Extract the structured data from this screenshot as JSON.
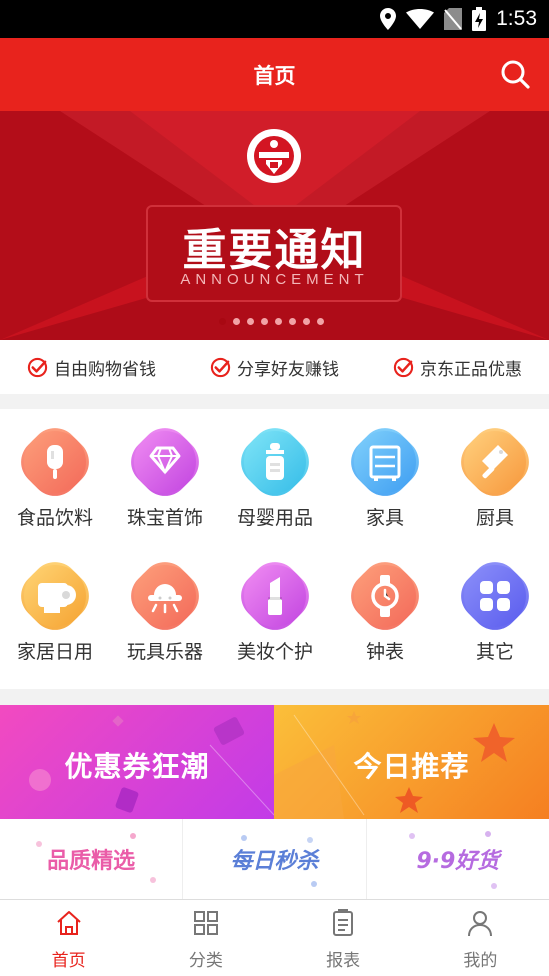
{
  "status_bar": {
    "time": "1:53"
  },
  "header": {
    "title": "首页"
  },
  "banner": {
    "headline": "重要通知",
    "subline": "ANNOUNCEMENT",
    "dot_count": 8,
    "active_dot": 0
  },
  "features": [
    {
      "label": "自由购物省钱"
    },
    {
      "label": "分享好友赚钱"
    },
    {
      "label": "京东正品优惠"
    }
  ],
  "categories": [
    {
      "label": "食品饮料",
      "icon": "popsicle-icon",
      "color_a": "#fd9e7a",
      "color_b": "#f36a5a"
    },
    {
      "label": "珠宝首饰",
      "icon": "diamond-icon",
      "color_a": "#f08cf2",
      "color_b": "#c245e0"
    },
    {
      "label": "母婴用品",
      "icon": "baby-bottle-icon",
      "color_a": "#7fe4f7",
      "color_b": "#36bde8"
    },
    {
      "label": "家具",
      "icon": "cabinet-icon",
      "color_a": "#80d0fb",
      "color_b": "#3f9ef2"
    },
    {
      "label": "厨具",
      "icon": "cleaver-icon",
      "color_a": "#ffd07d",
      "color_b": "#f7983d"
    },
    {
      "label": "家居日用",
      "icon": "toilet-paper-icon",
      "color_a": "#ffd474",
      "color_b": "#f5a332"
    },
    {
      "label": "玩具乐器",
      "icon": "ufo-toy-icon",
      "color_a": "#fd9e7a",
      "color_b": "#f36a5a"
    },
    {
      "label": "美妆个护",
      "icon": "lipstick-icon",
      "color_a": "#f08cf2",
      "color_b": "#c245e0"
    },
    {
      "label": "钟表",
      "icon": "watch-icon",
      "color_a": "#fd9e7a",
      "color_b": "#f36a5a"
    },
    {
      "label": "其它",
      "icon": "grid-apps-icon",
      "color_a": "#8b8ff9",
      "color_b": "#5a5cee"
    }
  ],
  "promos": [
    {
      "label": "优惠券狂潮"
    },
    {
      "label": "今日推荐"
    }
  ],
  "quick_links": [
    {
      "label": "品质精选"
    },
    {
      "label": "每日秒杀"
    },
    {
      "label": "9·9好货"
    }
  ],
  "tabs": [
    {
      "label": "首页",
      "icon": "home-icon",
      "active": true
    },
    {
      "label": "分类",
      "icon": "category-grid-icon",
      "active": false
    },
    {
      "label": "报表",
      "icon": "report-icon",
      "active": false
    },
    {
      "label": "我的",
      "icon": "person-icon",
      "active": false
    }
  ],
  "colors": {
    "brand_red": "#e8231d",
    "tab_inactive": "#777777"
  }
}
